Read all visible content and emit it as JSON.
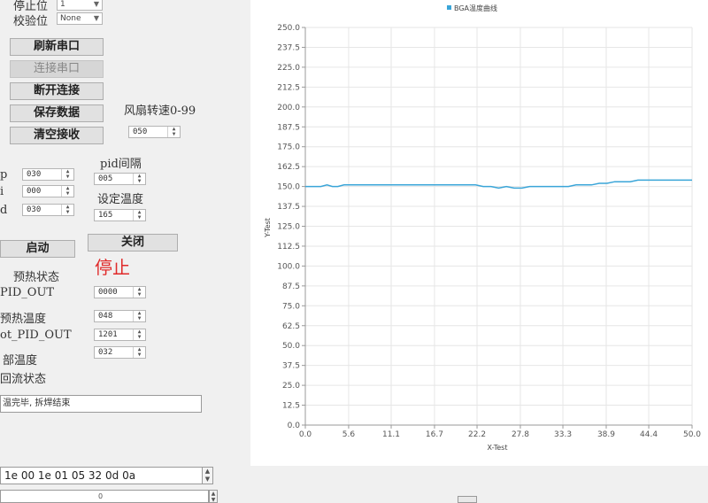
{
  "serial": {
    "stop_bits_label": "停止位",
    "stop_bits_value": "1",
    "parity_label": "校验位",
    "parity_value": "None"
  },
  "buttons": {
    "refresh_port": "刷新串口",
    "connect_port": "连接串口",
    "disconnect": "断开连接",
    "save_data": "保存数据",
    "clear_receive": "清空接收",
    "start": "启动",
    "close": "关闭"
  },
  "fan": {
    "label": "风扇转速0-99",
    "value": "050"
  },
  "pid": {
    "p_label": "p",
    "p_value": "030",
    "i_label": "i",
    "i_value": "000",
    "d_label": "d",
    "d_value": "030",
    "interval_label": "pid间隔",
    "interval_value": "005",
    "set_temp_label": "设定温度",
    "set_temp_value": "165"
  },
  "status": {
    "run_state": "停止",
    "preheat_state_label": "预热状态",
    "pid_out_label": "PID_OUT",
    "pid_out_value": "0000",
    "preheat_temp_label": "预热温度",
    "preheat_temp_value": "048",
    "hot_pid_out_label": "ot_PID_OUT",
    "hot_pid_out_value": "1201",
    "top_temp_label": "部温度",
    "top_temp_value": "032",
    "reflow_state_label": "回流状态",
    "message": "温完毕, 拆焊结束"
  },
  "send": {
    "hex": "1e 00 1e 01 05 32 0d 0a",
    "counter": "0"
  },
  "chart_data": {
    "type": "line",
    "title": "",
    "legend": "BGA温度曲线",
    "legend_placement": "top-center",
    "xlabel": "X-Test",
    "ylabel": "Y-Test",
    "xlim": [
      0,
      50
    ],
    "ylim": [
      0,
      250
    ],
    "grid": true,
    "color": "#3aa5d8",
    "xticks": [
      "0.0",
      "5.6",
      "11.1",
      "16.7",
      "22.2",
      "27.8",
      "33.3",
      "38.9",
      "44.4",
      "50.0"
    ],
    "yticks": [
      "0.0",
      "12.5",
      "25.0",
      "37.5",
      "50.0",
      "62.5",
      "75.0",
      "87.5",
      "100.0",
      "112.5",
      "125.0",
      "137.5",
      "150.0",
      "162.5",
      "175.0",
      "187.5",
      "200.0",
      "212.5",
      "225.0",
      "237.5",
      "250.0"
    ],
    "series": [
      {
        "name": "BGA温度曲线",
        "x": [
          0,
          1,
          2,
          2.8,
          3.5,
          4.2,
          5,
          6,
          8,
          10,
          12,
          14,
          16,
          18,
          20,
          22,
          23,
          24,
          25,
          26,
          27,
          28,
          29,
          30,
          31,
          32,
          33,
          34,
          35,
          36,
          37,
          38,
          39,
          40,
          41,
          42,
          43,
          44,
          45,
          46,
          47,
          48,
          49,
          50
        ],
        "y": [
          150,
          150,
          150,
          151,
          150,
          150,
          151,
          151,
          151,
          151,
          151,
          151,
          151,
          151,
          151,
          151,
          150,
          150,
          149,
          150,
          149,
          149,
          150,
          150,
          150,
          150,
          150,
          150,
          151,
          151,
          151,
          152,
          152,
          153,
          153,
          153,
          154,
          154,
          154,
          154,
          154,
          154,
          154,
          154
        ]
      }
    ]
  }
}
